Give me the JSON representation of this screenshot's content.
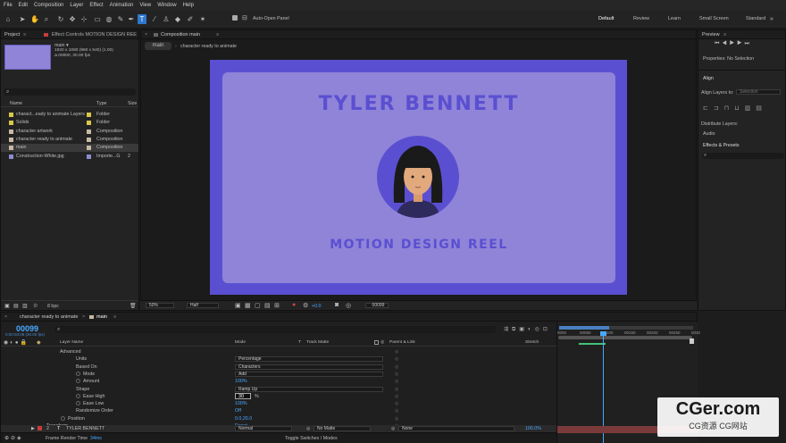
{
  "menu": [
    "File",
    "Edit",
    "Composition",
    "Layer",
    "Effect",
    "Animation",
    "View",
    "Window",
    "Help"
  ],
  "toolbar": {
    "auto_open": "Auto-Open Panel",
    "workspaces": [
      "Default",
      "Review",
      "Learn",
      "Small Screen",
      "Standard"
    ]
  },
  "project": {
    "tab": "Project",
    "effect_tab": "Effect Controls MOTION DESIGN REE",
    "info_name": "main ▾",
    "info_res": "1920 x 1080  (960 x 540) (1.00)",
    "info_dur": "Δ 00000, 30.00 fps",
    "headers": [
      "Name",
      "Type",
      "Size"
    ],
    "items": [
      {
        "name": "charact...eady to animate Layers",
        "type": "Folder",
        "color": "#d9c84a",
        "size": ""
      },
      {
        "name": "Solids",
        "type": "Folder",
        "color": "#d9c84a",
        "size": ""
      },
      {
        "name": "character artwork",
        "type": "Composition",
        "color": "#c8b9a4",
        "size": ""
      },
      {
        "name": "character ready to animate",
        "type": "Composition",
        "color": "#c8b9a4",
        "size": ""
      },
      {
        "name": "main",
        "type": "Composition",
        "color": "#c8b9a4",
        "size": ""
      },
      {
        "name": "Construction-White.jpg",
        "type": "Importe...G",
        "color": "#8c8cd0",
        "size": "2"
      }
    ],
    "bpc": "8 bpc"
  },
  "comp": {
    "tab": "Composition main",
    "crumbs": [
      "main",
      "character ready to animate"
    ],
    "title": "TYLER BENNETT",
    "subtitle": "MOTION DESIGN REEL",
    "zoom": "50%",
    "res": "Half",
    "exposure": "+0.0",
    "timecode": "00099"
  },
  "right": {
    "preview": "Preview",
    "props": "Properties: No Selection",
    "align": "Align",
    "align_to": "Align Layers to:",
    "selection": "Selection",
    "distribute": "Distribute Layers:",
    "audio": "Audio",
    "effects": "Effects & Presets"
  },
  "timeline": {
    "tabs": [
      "character ready to animate",
      "main"
    ],
    "timecode": "00099",
    "timecode_sub": "0:00:03:09 (30.00 fps)",
    "cols": [
      "Layer Name",
      "Mode",
      "T",
      "Track Matte",
      "Parent & Link",
      "Stretch"
    ],
    "ruler": [
      "0000",
      "00050",
      "00100",
      "00150",
      "00200",
      "00250",
      "0030"
    ],
    "rows": [
      {
        "label": "Advanced",
        "indent": 66,
        "value": ""
      },
      {
        "label": "Units",
        "indent": 84,
        "value": "Percentage",
        "dd": true
      },
      {
        "label": "Based On",
        "indent": 84,
        "value": "Characters",
        "dd": true
      },
      {
        "label": "Mode",
        "indent": 92,
        "value": "Add",
        "dd": true,
        "circ": true
      },
      {
        "label": "Amount",
        "indent": 92,
        "value": "100%",
        "blue": true,
        "circ": true
      },
      {
        "label": "Shape",
        "indent": 84,
        "value": "Ramp Up",
        "dd": true
      },
      {
        "label": "Ease High",
        "indent": 92,
        "value": "30",
        "unit": "%",
        "box": true,
        "circ": true
      },
      {
        "label": "Ease Low",
        "indent": 92,
        "value": "100%",
        "blue": true,
        "circ": true
      },
      {
        "label": "Randomize Order",
        "indent": 84,
        "value": "Off",
        "blue": true
      },
      {
        "label": "Position",
        "indent": 75,
        "value": "0.0,20.0",
        "blue": true,
        "circ": true
      },
      {
        "label": "Transform",
        "indent": 51,
        "value": "Reset",
        "blue": true
      }
    ],
    "layer": {
      "num": "2",
      "name": "TYLER BENNETT",
      "mode": "Normal",
      "matte": "No Matte",
      "parent": "None",
      "stretch": "100.0%"
    },
    "render_time_label": "Frame Render Time",
    "render_time": "34ms",
    "toggle": "Toggle Switches / Modes"
  },
  "watermark": {
    "big": "CGer.com",
    "small": "CG资源 CG网站"
  }
}
